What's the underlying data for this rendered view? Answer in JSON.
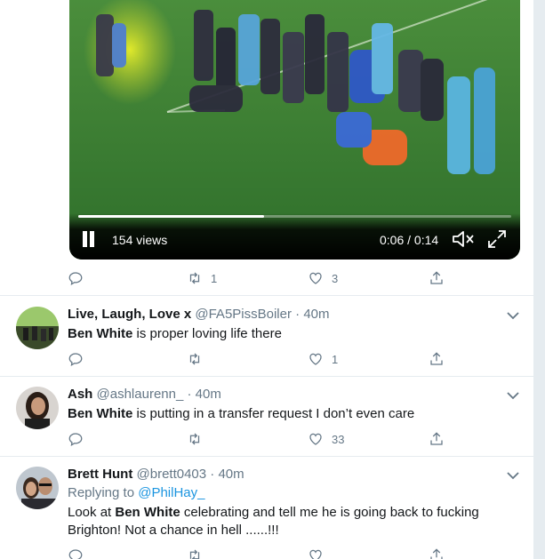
{
  "video": {
    "views": "154 views",
    "time": "0:06 / 0:14",
    "progress": 0.43
  },
  "main_actions": {
    "reply": "",
    "retweet": "1",
    "like": "3"
  },
  "tweets": [
    {
      "name": "Live, Laugh, Love x",
      "handle": "@FA5PissBoiler",
      "dot": "·",
      "ago": "40m",
      "highlight": "Ben White",
      "text": " is proper loving life there",
      "retweets": "",
      "likes": "1"
    },
    {
      "name": "Ash",
      "handle": "@ashlaurenn_",
      "dot": "·",
      "ago": "40m",
      "highlight": "Ben White",
      "text": " is putting in a transfer request I don’t even care",
      "retweets": "",
      "likes": "33"
    },
    {
      "name": "Brett Hunt",
      "handle": "@brett0403",
      "dot": "·",
      "ago": "40m",
      "replying_prefix": "Replying to ",
      "replying_to": "@PhilHay_",
      "pre": "Look at ",
      "highlight": "Ben White",
      "text": " celebrating and tell me he is going back to fucking Brighton! Not a chance in hell ......!!!",
      "retweets": "",
      "likes": ""
    }
  ],
  "icons": {
    "reply": "reply-icon",
    "retweet": "retweet-icon",
    "like": "heart-icon",
    "share": "share-icon",
    "caret": "chevron-down-icon"
  },
  "colors": {
    "muted": "#657786",
    "link": "#1b95e0",
    "text": "#14171a"
  }
}
